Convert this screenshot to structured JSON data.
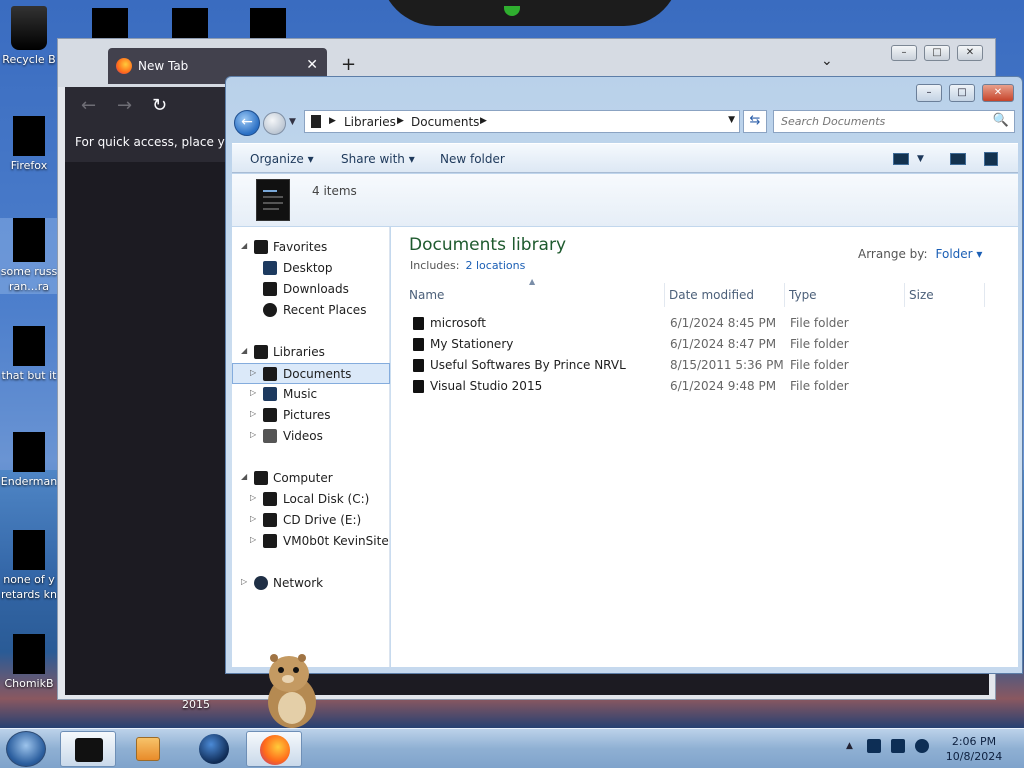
{
  "desktop": {
    "icons": [
      {
        "label": "Recycle B",
        "icon": "recycle-bin-icon"
      },
      {
        "label": "Firefox",
        "icon": "firefox-icon"
      },
      {
        "label": "some russ\nran...ra",
        "icon": "file-icon"
      },
      {
        "label": "that but it",
        "icon": "file-icon"
      },
      {
        "label": "Enderman",
        "icon": "file-icon"
      },
      {
        "label": "none of y\nretards kn",
        "icon": "file-icon"
      },
      {
        "label": "ChomikB",
        "icon": "file-icon"
      }
    ],
    "bottom_label": "2015"
  },
  "firefox": {
    "tab_title": "New Tab",
    "tab_close": "✕",
    "new_tab": "+",
    "tab_list": "⌄",
    "back": "←",
    "forward": "→",
    "reload": "↻",
    "quick_access_hint": "For quick access, place your",
    "minimize": "–",
    "maximize": "□",
    "close": "✕"
  },
  "explorer": {
    "caption": {
      "minimize": "–",
      "maximize": "□",
      "close": "✕"
    },
    "back": "←",
    "breadcrumbs": [
      "Libraries",
      "Documents"
    ],
    "refresh": "⇆",
    "search_placeholder": "Search Documents",
    "search_icon": "🔍",
    "toolbar": {
      "organize": "Organize ▾",
      "share_with": "Share with ▾",
      "new_folder": "New folder"
    },
    "items_count": "4 items",
    "nav": {
      "favorites": "Favorites",
      "desktop": "Desktop",
      "downloads": "Downloads",
      "recent_places": "Recent Places",
      "libraries": "Libraries",
      "documents": "Documents",
      "music": "Music",
      "pictures": "Pictures",
      "videos": "Videos",
      "computer": "Computer",
      "local_disk": "Local Disk (C:)",
      "cd_drive": "CD Drive (E:)",
      "network_share": "VM0b0t KevinSite",
      "network": "Network"
    },
    "library_title": "Documents library",
    "includes_label": "Includes:",
    "includes_link": "2 locations",
    "arrange_label": "Arrange by:",
    "arrange_value": "Folder ▾",
    "columns": {
      "name": "Name",
      "date_modified": "Date modified",
      "type": "Type",
      "size": "Size"
    },
    "files": [
      {
        "name": "microsoft",
        "date": "6/1/2024 8:45 PM",
        "type": "File folder",
        "size": ""
      },
      {
        "name": "My Stationery",
        "date": "6/1/2024 8:47 PM",
        "type": "File folder",
        "size": ""
      },
      {
        "name": "Useful Softwares By Prince NRVL",
        "date": "8/15/2011 5:36 PM",
        "type": "File folder",
        "size": ""
      },
      {
        "name": "Visual Studio 2015",
        "date": "6/1/2024 9:48 PM",
        "type": "File folder",
        "size": ""
      }
    ]
  },
  "taskbar": {
    "time": "2:06 PM",
    "date": "10/8/2024",
    "show_hidden": "▲"
  }
}
